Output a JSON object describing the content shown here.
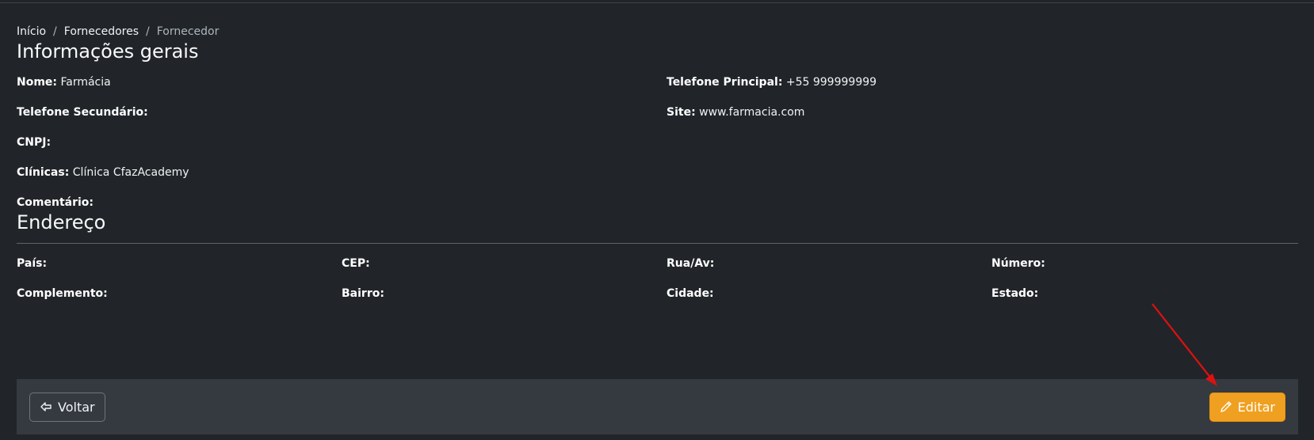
{
  "breadcrumb": {
    "items": [
      "Início",
      "Fornecedores"
    ],
    "separator": "/",
    "current": "Fornecedor"
  },
  "general": {
    "title": "Informações gerais",
    "fields": {
      "nome": {
        "label": "Nome:",
        "value": "Farmácia"
      },
      "telefone_principal": {
        "label": "Telefone Principal:",
        "value": "+55 999999999"
      },
      "telefone_secundario": {
        "label": "Telefone Secundário:",
        "value": ""
      },
      "site": {
        "label": "Site:",
        "value": "www.farmacia.com"
      },
      "cnpj": {
        "label": "CNPJ:",
        "value": ""
      },
      "clinicas": {
        "label": "Clínicas:",
        "value": "Clínica CfazAcademy"
      },
      "comentario": {
        "label": "Comentário:",
        "value": ""
      }
    }
  },
  "address": {
    "title": "Endereço",
    "fields": {
      "pais": {
        "label": "País:",
        "value": ""
      },
      "cep": {
        "label": "CEP:",
        "value": ""
      },
      "rua": {
        "label": "Rua/Av:",
        "value": ""
      },
      "numero": {
        "label": "Número:",
        "value": ""
      },
      "complemento": {
        "label": "Complemento:",
        "value": ""
      },
      "bairro": {
        "label": "Bairro:",
        "value": ""
      },
      "cidade": {
        "label": "Cidade:",
        "value": ""
      },
      "estado": {
        "label": "Estado:",
        "value": ""
      }
    }
  },
  "actions": {
    "back_label": "Voltar",
    "back_icon": "arrow-left-icon",
    "edit_label": "Editar",
    "edit_icon": "pencil-icon"
  },
  "colors": {
    "background": "#212529",
    "action_bar": "#343a40",
    "edit_button": "#f0a020",
    "annotation_arrow": "#e01010"
  }
}
